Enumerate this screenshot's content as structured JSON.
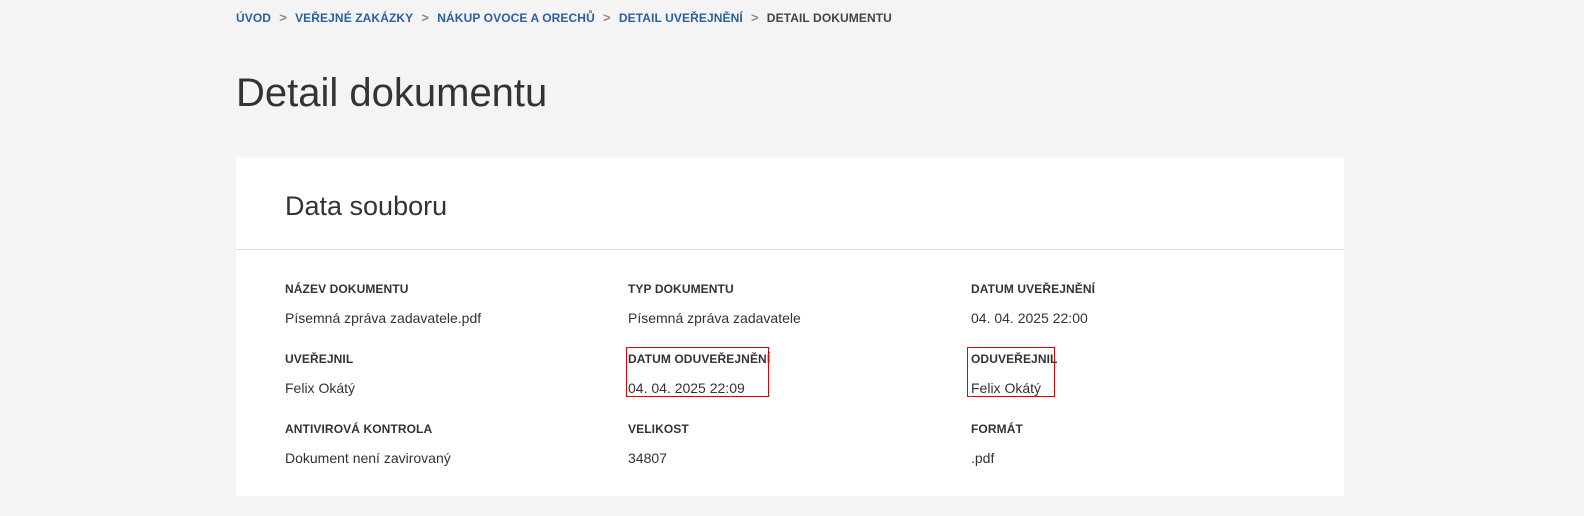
{
  "breadcrumb": {
    "items": [
      "ÚVOD",
      "VEŘEJNÉ ZAKÁZKY",
      "NÁKUP OVOCE A ORECHŮ",
      "DETAIL UVEŘEJNĚNÍ"
    ],
    "current": "DETAIL DOKUMENTU",
    "separator": ">"
  },
  "page": {
    "title": "Detail dokumentu"
  },
  "card": {
    "title": "Data souboru",
    "fields": [
      {
        "label": "NÁZEV DOKUMENTU",
        "value": "Písemná zpráva zadavatele.pdf"
      },
      {
        "label": "TYP DOKUMENTU",
        "value": "Písemná zpráva zadavatele"
      },
      {
        "label": "DATUM UVEŘEJNĚNÍ",
        "value": "04. 04. 2025 22:00"
      },
      {
        "label": "UVEŘEJNIL",
        "value": "Felix Okátý"
      },
      {
        "label": "DATUM ODUVEŘEJNĚNÍ",
        "value": "04. 04. 2025 22:09"
      },
      {
        "label": "ODUVEŘEJNIL",
        "value": "Felix Okátý"
      },
      {
        "label": "ANTIVIROVÁ KONTROLA",
        "value": "Dokument není zavirovaný"
      },
      {
        "label": "VELIKOST",
        "value": "34807"
      },
      {
        "label": "FORMÁT",
        "value": ".pdf"
      }
    ]
  },
  "colors": {
    "background": "#f4f4f4",
    "card": "#ffffff",
    "link": "#2a5fa3",
    "text": "#333333",
    "highlight": "#e00000"
  }
}
